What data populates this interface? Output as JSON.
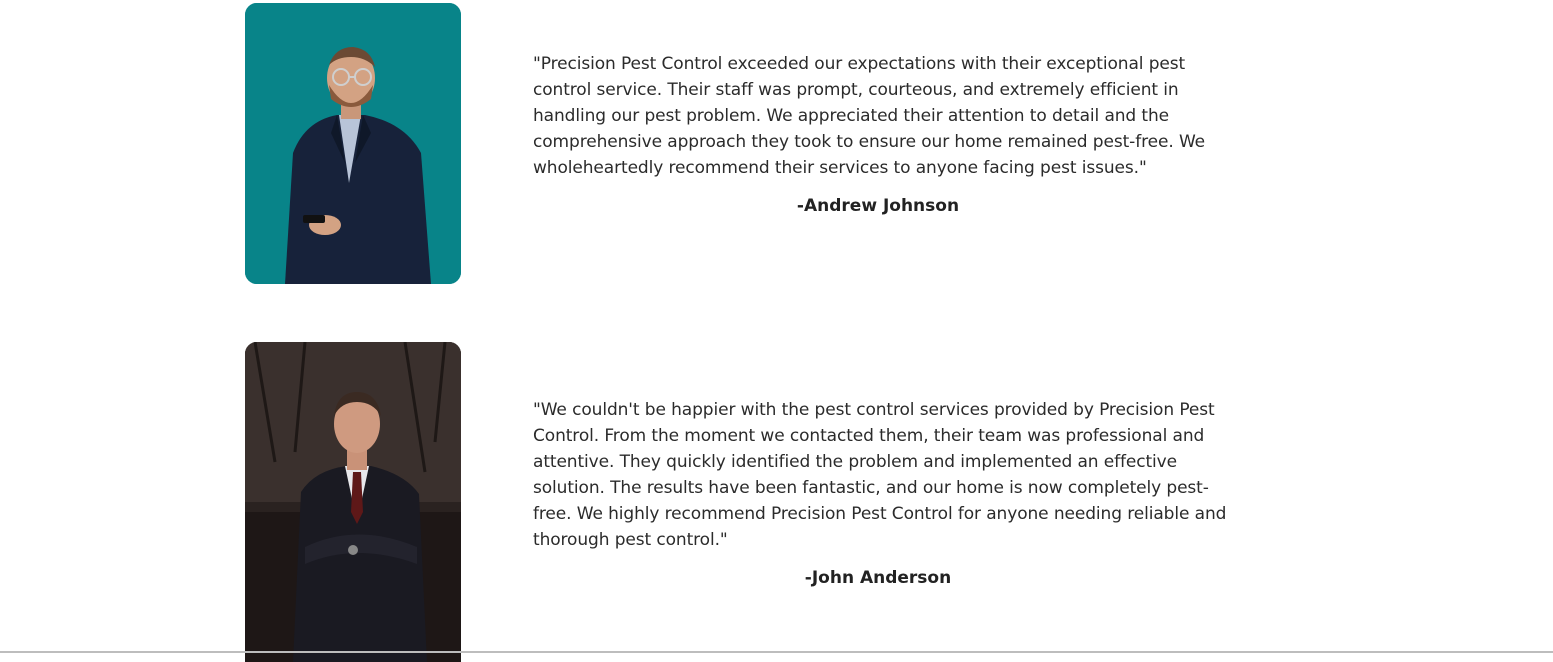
{
  "testimonials": [
    {
      "quote": "\"Precision Pest Control exceeded our expectations with their exceptional pest control service. Their staff was prompt, courteous, and extremely efficient in handling our pest problem. We appreciated their attention to detail and the comprehensive approach they took to ensure our home remained pest-free. We wholeheartedly recommend their services to anyone facing pest issues.\"",
      "author": "-Andrew Johnson",
      "photo_background": "#078a8f"
    },
    {
      "quote": "\"We couldn't be happier with the pest control services provided by Precision Pest Control. From the moment we contacted them, their team was professional and attentive. They quickly identified the problem and implemented an effective solution. The results have been fantastic, and our home is now completely pest-free. We highly recommend Precision Pest Control for anyone needing reliable and thorough pest control.\"",
      "author": "-John Anderson",
      "photo_background": "#2a2220"
    }
  ]
}
